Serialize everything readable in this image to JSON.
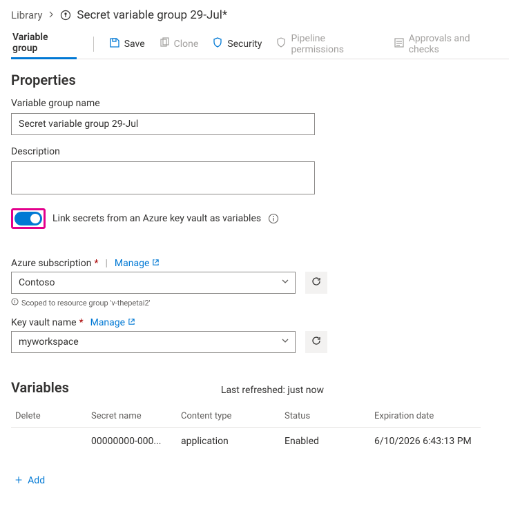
{
  "breadcrumb": {
    "library_label": "Library",
    "title": "Secret variable group 29-Jul*"
  },
  "tabs": {
    "variable_group": "Variable group"
  },
  "toolbar": {
    "save": "Save",
    "clone": "Clone",
    "security": "Security",
    "pipeline_permissions": "Pipeline permissions",
    "approvals_checks": "Approvals and checks"
  },
  "properties": {
    "heading": "Properties",
    "name_label": "Variable group name",
    "name_value": "Secret variable group 29-Jul",
    "description_label": "Description",
    "description_value": "",
    "link_kv_label": "Link secrets from an Azure key vault as variables",
    "link_kv_on": true
  },
  "azure": {
    "subscription_label": "Azure subscription",
    "manage": "Manage",
    "subscription_value": "Contoso",
    "scope_note": "Scoped to resource group 'v-thepetai2'",
    "keyvault_label": "Key vault name",
    "keyvault_value": "myworkspace"
  },
  "variables": {
    "heading": "Variables",
    "last_refreshed": "Last refreshed: just now",
    "col_delete": "Delete",
    "col_secret_name": "Secret name",
    "col_content_type": "Content type",
    "col_status": "Status",
    "col_expiration": "Expiration date",
    "rows": [
      {
        "secret_name": "00000000-000...",
        "content_type": "application",
        "status": "Enabled",
        "expiration": "6/10/2026 6:43:13 PM"
      }
    ],
    "add": "Add"
  }
}
